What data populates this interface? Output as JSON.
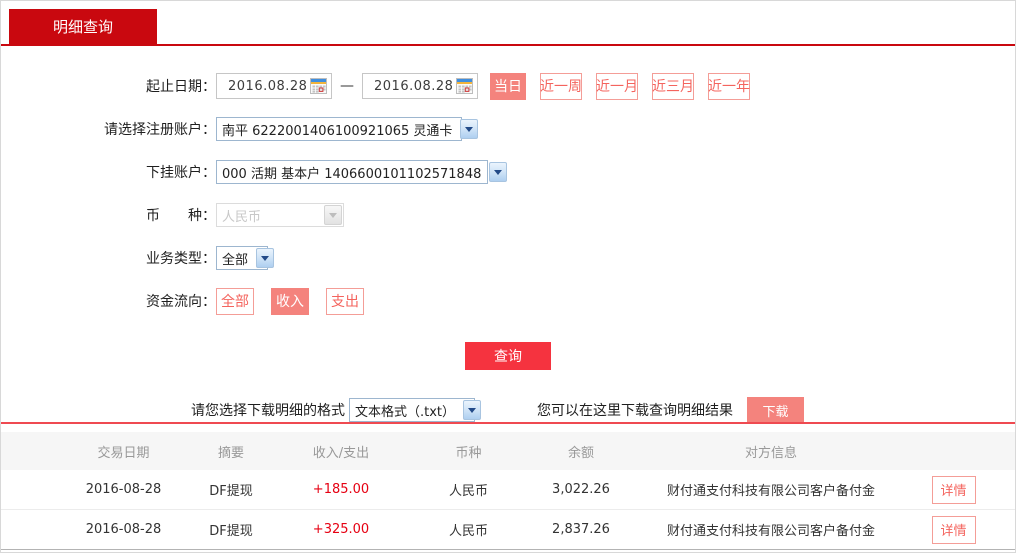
{
  "tab": {
    "label": "明细查询"
  },
  "colors": {
    "brand_red": "#c9080f",
    "query_button_red": "#f5333f",
    "salmon": "#f4837d",
    "table_divider_red": "#ef4a51"
  },
  "form": {
    "date_range": {
      "label": "起止日期：",
      "start_value": "2016.08.28",
      "end_value": "2016.08.28",
      "separator": "—",
      "quick_buttons": [
        {
          "label": "当日",
          "active": true
        },
        {
          "label": "近一周",
          "active": false
        },
        {
          "label": "近一月",
          "active": false
        },
        {
          "label": "近三月",
          "active": false
        },
        {
          "label": "近一年",
          "active": false
        }
      ]
    },
    "register_account": {
      "label": "请选择注册账户：",
      "value": "南平 6222001406100921065 灵通卡"
    },
    "sub_account": {
      "label": "下挂账户：",
      "value": "000 活期 基本户 1406600101102571848"
    },
    "currency": {
      "label": "币　　种：",
      "value": "人民币",
      "disabled": true
    },
    "business_type": {
      "label": "业务类型：",
      "value": "全部"
    },
    "fund_flow": {
      "label": "资金流向：",
      "options": [
        {
          "label": "全部",
          "active": false
        },
        {
          "label": "收入",
          "active": true
        },
        {
          "label": "支出",
          "active": false
        }
      ]
    },
    "query_button_label": "查询"
  },
  "download": {
    "format_label": "请您选择下载明细的格式",
    "format_value": "文本格式（.txt）",
    "hint": "您可以在这里下载查询明细结果",
    "button_label": "下载"
  },
  "table": {
    "headers": [
      "交易日期",
      "摘要",
      "收入/支出",
      "币种",
      "余额",
      "对方信息"
    ],
    "rows": [
      {
        "date": "2016-08-28",
        "summary": "DF提现",
        "amount": "+185.00",
        "currency": "人民币",
        "balance": "3,022.26",
        "counterparty": "财付通支付科技有限公司客户备付金",
        "action": "详情"
      },
      {
        "date": "2016-08-28",
        "summary": "DF提现",
        "amount": "+325.00",
        "currency": "人民币",
        "balance": "2,837.26",
        "counterparty": "财付通支付科技有限公司客户备付金",
        "action": "详情"
      }
    ]
  },
  "icons": {
    "calendar": "calendar-icon",
    "dropdown": "chevron-down-icon"
  }
}
